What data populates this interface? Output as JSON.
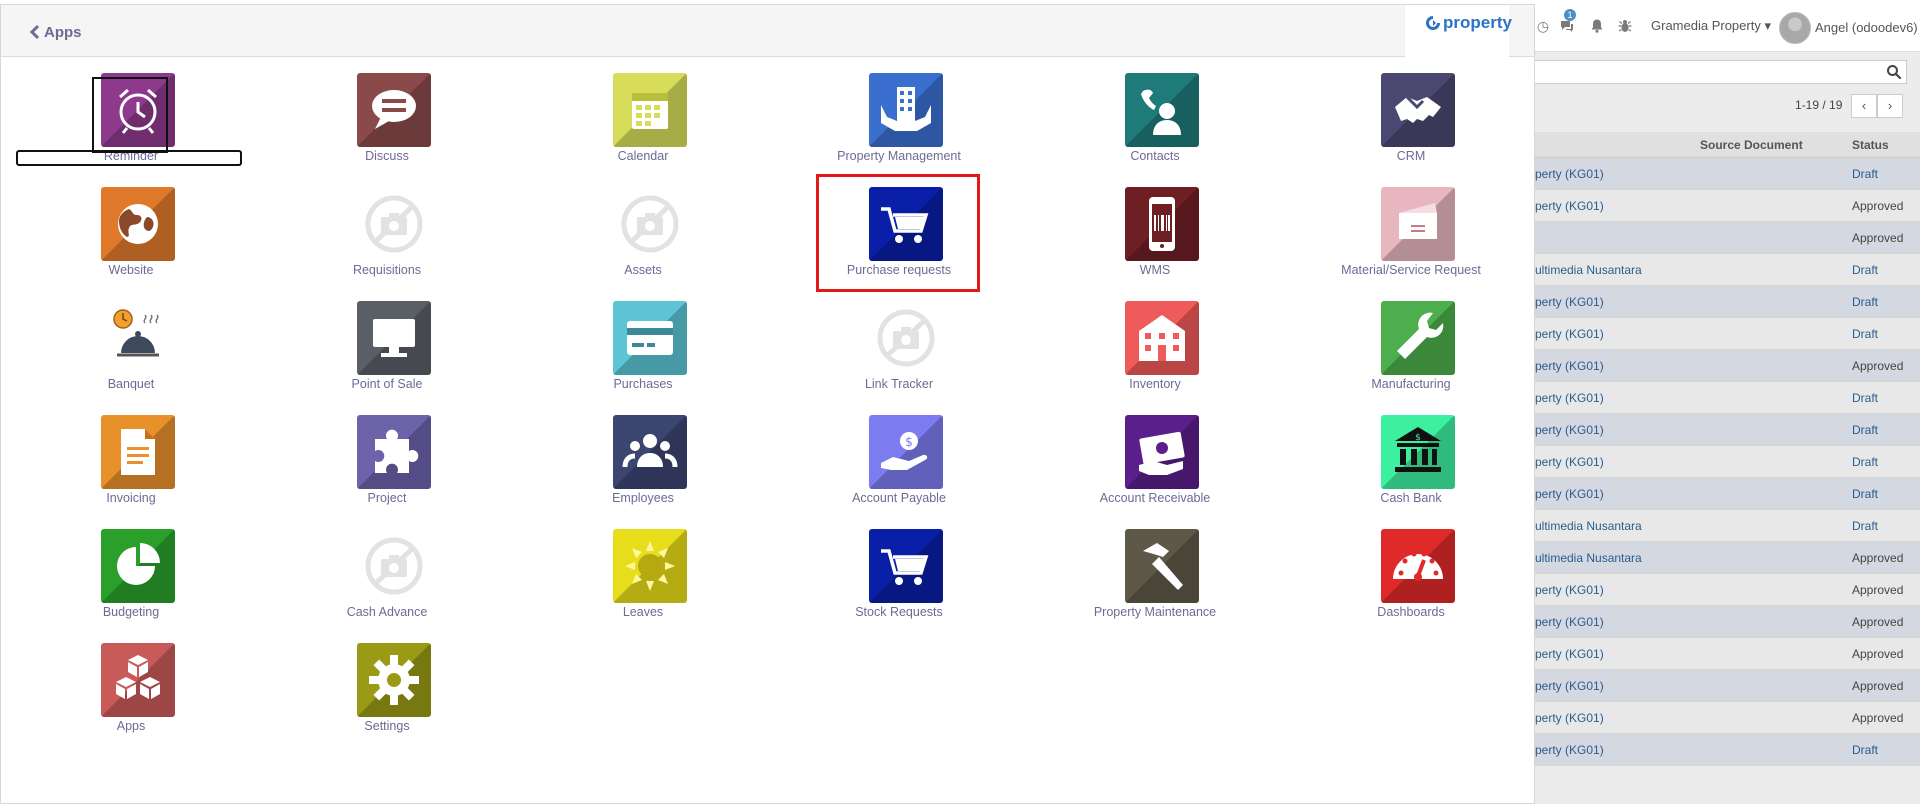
{
  "header": {
    "back_label": "Apps",
    "logo_text": "property"
  },
  "topbar": {
    "chat_badge": "1",
    "company": "Gramedia Property",
    "user": "Angel (odoodev6)"
  },
  "list": {
    "pager": "1-19 / 19",
    "columns": {
      "source": "Source Document",
      "status": "Status"
    },
    "rows": [
      {
        "source": "perty (KG01)",
        "status": "Draft"
      },
      {
        "source": "perty (KG01)",
        "status": "Approved"
      },
      {
        "source": "",
        "status": "Approved"
      },
      {
        "source": "ultimedia Nusantara",
        "status": "Draft"
      },
      {
        "source": "perty (KG01)",
        "status": "Draft"
      },
      {
        "source": "perty (KG01)",
        "status": "Draft"
      },
      {
        "source": "perty (KG01)",
        "status": "Approved"
      },
      {
        "source": "perty (KG01)",
        "status": "Draft"
      },
      {
        "source": "perty (KG01)",
        "status": "Draft"
      },
      {
        "source": "perty (KG01)",
        "status": "Draft"
      },
      {
        "source": "perty (KG01)",
        "status": "Draft"
      },
      {
        "source": "ultimedia Nusantara",
        "status": "Draft"
      },
      {
        "source": "ultimedia Nusantara",
        "status": "Approved"
      },
      {
        "source": "perty (KG01)",
        "status": "Approved"
      },
      {
        "source": "perty (KG01)",
        "status": "Approved"
      },
      {
        "source": "perty (KG01)",
        "status": "Approved"
      },
      {
        "source": "perty (KG01)",
        "status": "Approved"
      },
      {
        "source": "perty (KG01)",
        "status": "Approved"
      },
      {
        "source": "perty (KG01)",
        "status": "Draft"
      }
    ]
  },
  "apps": [
    {
      "label": "Reminder",
      "icon": "alarm-clock-icon",
      "color": "#8e3a8c"
    },
    {
      "label": "Discuss",
      "icon": "chat-bubble-icon",
      "color": "#8a4a4a"
    },
    {
      "label": "Calendar",
      "icon": "calendar-icon",
      "color": "#d7dd5a"
    },
    {
      "label": "Property Management",
      "icon": "building-hands-icon",
      "color": "#3a6fd0"
    },
    {
      "label": "Contacts",
      "icon": "contact-phone-icon",
      "color": "#1f7a7a"
    },
    {
      "label": "CRM",
      "icon": "handshake-icon",
      "color": "#4a4870"
    },
    {
      "label": "Website",
      "icon": "globe-icon",
      "color": "#e07a2a"
    },
    {
      "label": "Requisitions",
      "icon": "no-camera-icon",
      "color": "#ffffff"
    },
    {
      "label": "Assets",
      "icon": "no-camera-icon",
      "color": "#ffffff"
    },
    {
      "label": "Purchase requests",
      "icon": "shopping-cart-icon",
      "color": "#0a1fa8"
    },
    {
      "label": "WMS",
      "icon": "mobile-barcode-icon",
      "color": "#6e1f24"
    },
    {
      "label": "Material/Service Request",
      "icon": "envelope-card-icon",
      "color": "#e8b6bf"
    },
    {
      "label": "Banquet",
      "icon": "food-cloche-icon",
      "color": "#ffffff"
    },
    {
      "label": "Point of Sale",
      "icon": "monitor-icon",
      "color": "#5a5f66"
    },
    {
      "label": "Purchases",
      "icon": "credit-card-icon",
      "color": "#5cc4d4"
    },
    {
      "label": "Link Tracker",
      "icon": "no-camera-icon",
      "color": "#ffffff"
    },
    {
      "label": "Inventory",
      "icon": "warehouse-icon",
      "color": "#ef5a5a"
    },
    {
      "label": "Manufacturing",
      "icon": "wrench-icon",
      "color": "#4cae4c"
    },
    {
      "label": "Invoicing",
      "icon": "document-icon",
      "color": "#e8902a"
    },
    {
      "label": "Project",
      "icon": "puzzle-icon",
      "color": "#6c63aa"
    },
    {
      "label": "Employees",
      "icon": "people-icon",
      "color": "#3c4470"
    },
    {
      "label": "Account Payable",
      "icon": "hand-money-icon",
      "color": "#7c7cf0"
    },
    {
      "label": "Account Receivable",
      "icon": "cash-hand-icon",
      "color": "#5a1f8a"
    },
    {
      "label": "Cash Bank",
      "icon": "bank-icon",
      "color": "#3cf0a0"
    },
    {
      "label": "Budgeting",
      "icon": "pie-chart-icon",
      "color": "#2aa02a"
    },
    {
      "label": "Cash Advance",
      "icon": "no-camera-icon",
      "color": "#ffffff"
    },
    {
      "label": "Leaves",
      "icon": "sun-icon",
      "color": "#e8dd1a"
    },
    {
      "label": "Stock Requests",
      "icon": "shopping-cart-icon",
      "color": "#0a1fa8"
    },
    {
      "label": "Property Maintenance",
      "icon": "hammer-icon",
      "color": "#5e5848"
    },
    {
      "label": "Dashboards",
      "icon": "speedometer-icon",
      "color": "#e02a2a"
    },
    {
      "label": "Apps",
      "icon": "cubes-icon",
      "color": "#c95a5a"
    },
    {
      "label": "Settings",
      "icon": "gear-icon",
      "color": "#9a9a14"
    }
  ]
}
